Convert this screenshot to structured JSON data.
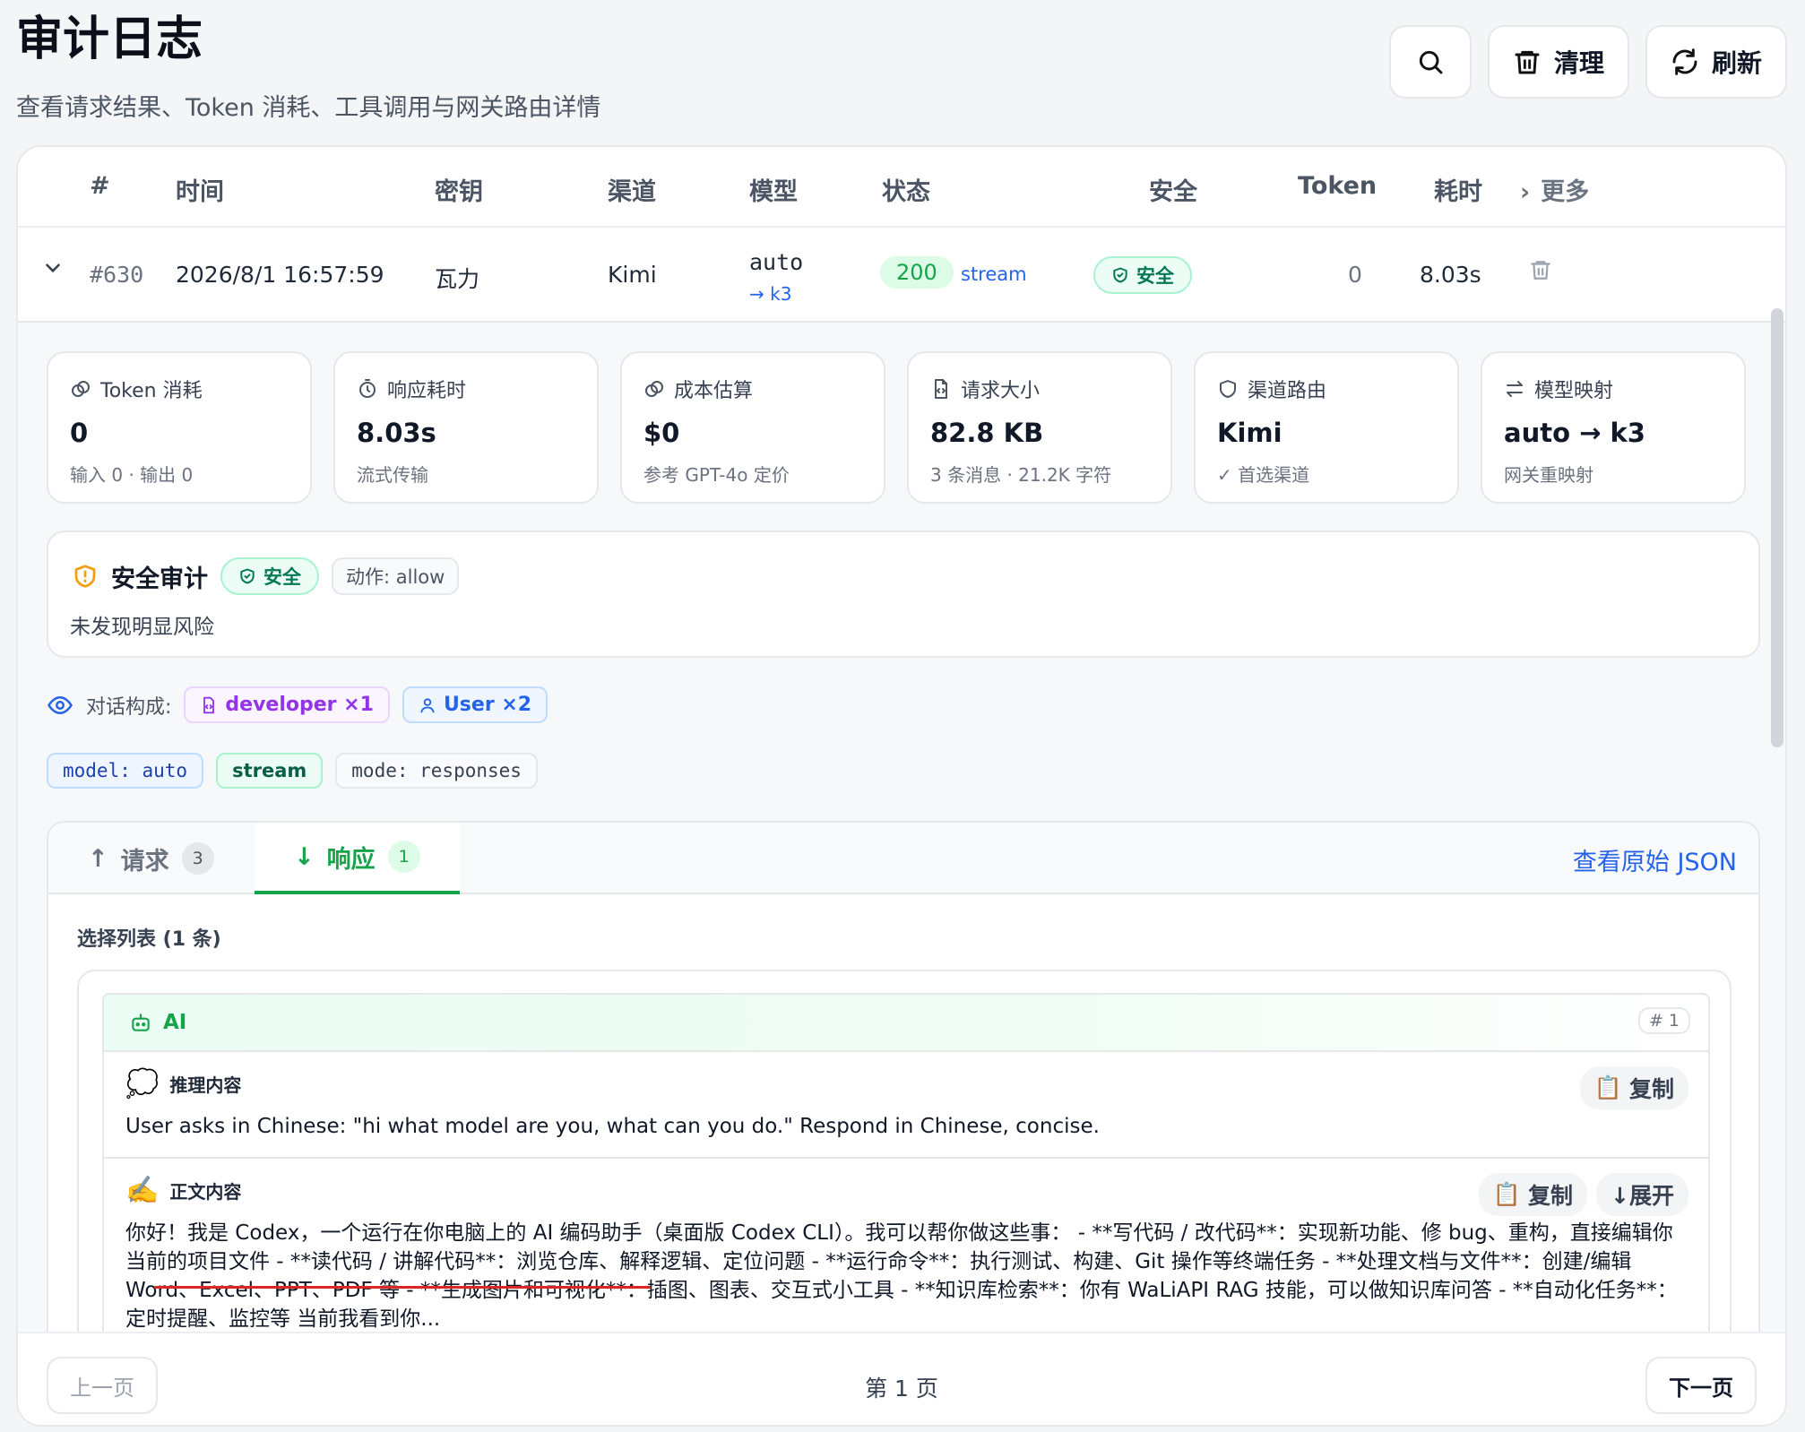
{
  "header": {
    "title": "审计日志",
    "subtitle": "查看请求结果、Token 消耗、工具调用与网关路由详情"
  },
  "toolbar": {
    "clear_label": "清理",
    "refresh_label": "刷新"
  },
  "table": {
    "columns": [
      "#",
      "时间",
      "密钥",
      "渠道",
      "模型",
      "状态",
      "安全",
      "Token",
      "耗时",
      "更多"
    ],
    "row": {
      "id": "#630",
      "time": "2026/8/1 16:57:59",
      "key": "瓦力",
      "channel": "Kimi",
      "model": "auto",
      "model_mapped": "k3",
      "status_code": "200",
      "status_type": "stream",
      "security": "安全",
      "tokens": "0",
      "duration": "8.03s"
    }
  },
  "stats": [
    {
      "label": "Token 消耗",
      "value": "0",
      "sub": "输入 0 · 输出 0",
      "icon": "coins-icon"
    },
    {
      "label": "响应耗时",
      "value": "8.03s",
      "sub": "流式传输",
      "icon": "timer-icon"
    },
    {
      "label": "成本估算",
      "value": "$0",
      "sub": "参考 GPT-4o 定价",
      "icon": "coins-icon"
    },
    {
      "label": "请求大小",
      "value": "82.8 KB",
      "sub": "3 条消息 · 21.2K 字符",
      "icon": "file-code-icon"
    },
    {
      "label": "渠道路由",
      "value": "Kimi",
      "sub": "✓ 首选渠道",
      "icon": "shield-icon"
    },
    {
      "label": "模型映射",
      "value": "auto → k3",
      "sub": "网关重映射",
      "icon": "arrows-swap-icon"
    }
  ],
  "security": {
    "title": "安全审计",
    "badge": "安全",
    "action": "动作: allow",
    "description": "未发现明显风险"
  },
  "composition": {
    "label": "对话构成:",
    "developer": "developer ×1",
    "user": "User ×2"
  },
  "params": {
    "model": "model: auto",
    "stream": "stream",
    "mode": "mode: responses"
  },
  "tabs": {
    "request_label": "请求",
    "request_count": "3",
    "response_label": "响应",
    "response_count": "1",
    "raw_json_link": "查看原始 JSON"
  },
  "response": {
    "list_title": "选择列表 (1 条)",
    "role": "AI",
    "index": "# 1",
    "reasoning_title": "推理内容",
    "reasoning_text": "User asks in Chinese: \"hi what model are you, what can you do.\" Respond in Chinese, concise.",
    "content_title": "正文内容",
    "content_text": "你好！我是 Codex，一个运行在你电脑上的 AI 编码助手（桌面版 Codex CLI）。我可以帮你做这些事： - **写代码 / 改代码**：实现新功能、修 bug、重构，直接编辑你当前的项目文件 - **读代码 / 讲解代码**：浏览仓库、解释逻辑、定位问题 - **运行命令**：执行测试、构建、Git 操作等终端任务 - **处理文档与文件**：创建/编辑 Word、Excel、PPT、PDF 等 - **生成图片和可视化**：插图、图表、交互式小工具 - **知识库检索**：你有 WaLiAPI RAG 技能，可以做知识库问答 - **自动化任务**：定时提醒、监控等 当前我看到你...",
    "copy_label": "复制",
    "expand_label": "↓展开"
  },
  "pager": {
    "prev": "上一页",
    "page": "第 1 页",
    "next": "下一页"
  }
}
